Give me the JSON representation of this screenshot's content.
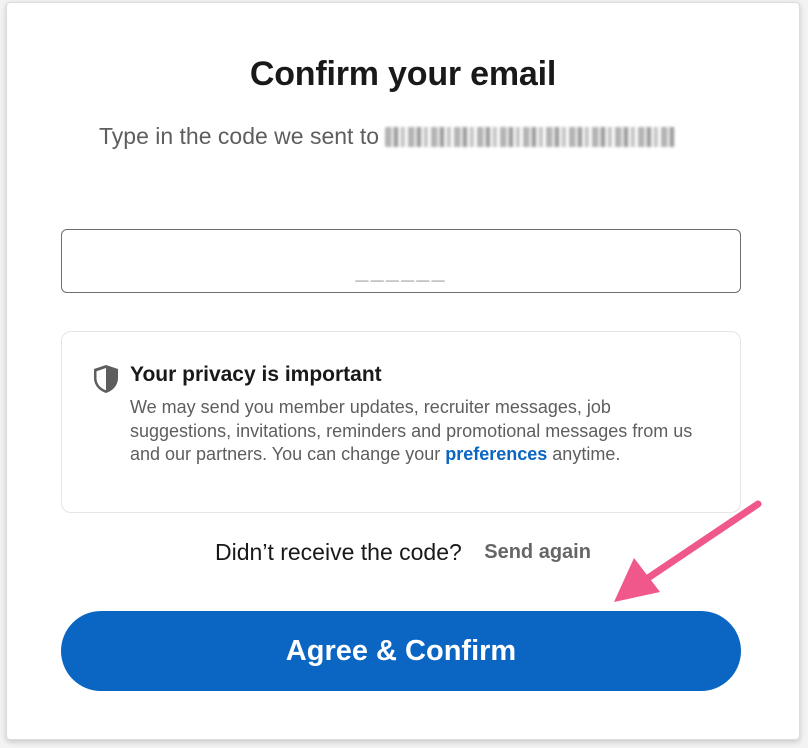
{
  "header": {
    "title": "Confirm your email",
    "subtitle": "Type in the code we sent to"
  },
  "code_field": {
    "value": "",
    "placeholder": "______"
  },
  "privacy": {
    "icon": "shield-icon",
    "title": "Your privacy is important",
    "body_before_link": "We may send you member updates, recruiter messages, job suggestions, invitations, reminders and promotional messages from us and our partners. You can change your ",
    "link_label": "preferences",
    "body_after_link": " anytime."
  },
  "resend": {
    "question": "Didn’t receive the code?",
    "button_label": "Send again"
  },
  "primary_button": {
    "label": "Agree & Confirm"
  },
  "colors": {
    "brand_blue": "#0a66c2",
    "annotation_arrow": "#f0578a"
  }
}
